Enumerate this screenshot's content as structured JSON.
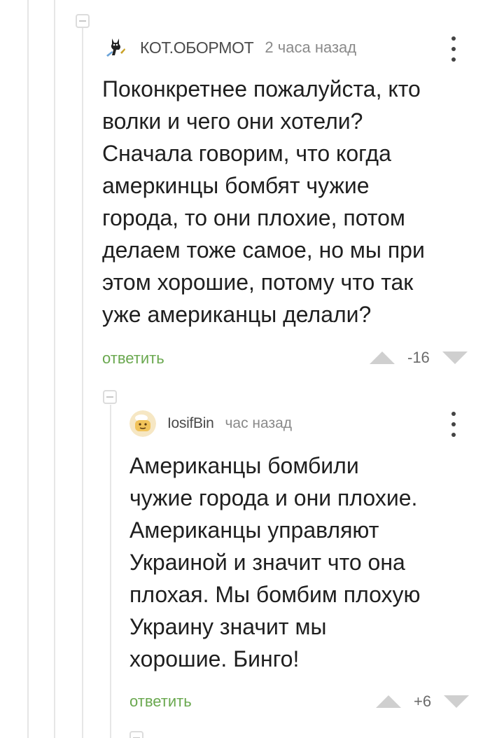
{
  "comments": [
    {
      "author": "КОТ.ОБОРМОТ",
      "time": "2 часа назад",
      "avatar_icon": "cat-avatar-icon",
      "text": "Поконкретнее пожалуйста, кто\nволки и чего они хотели?\nСначала говорим, что когда\nамеркинцы бомбят чужие\nгорода, то они плохие, потом\nделаем тоже самое, но мы при\nэтом хорошие, потому что так\nуже американцы делали?",
      "reply_label": "ответить",
      "score": "-16"
    },
    {
      "author": "IosifBin",
      "time": "час назад",
      "avatar_icon": "face-avatar-icon",
      "text": "Американцы бомбили\nчужие города и они плохие.\nАмериканцы управляют\nУкраиной и значит что она\nплохая. Мы бомбим плохую\nУкраину значит мы\nхорошие. Бинго!",
      "reply_label": "ответить",
      "score": "+6"
    }
  ],
  "colors": {
    "reply_link": "#6aa84f",
    "thread_line": "#e6e6e6",
    "vote_arrow": "#cfcfcf"
  }
}
